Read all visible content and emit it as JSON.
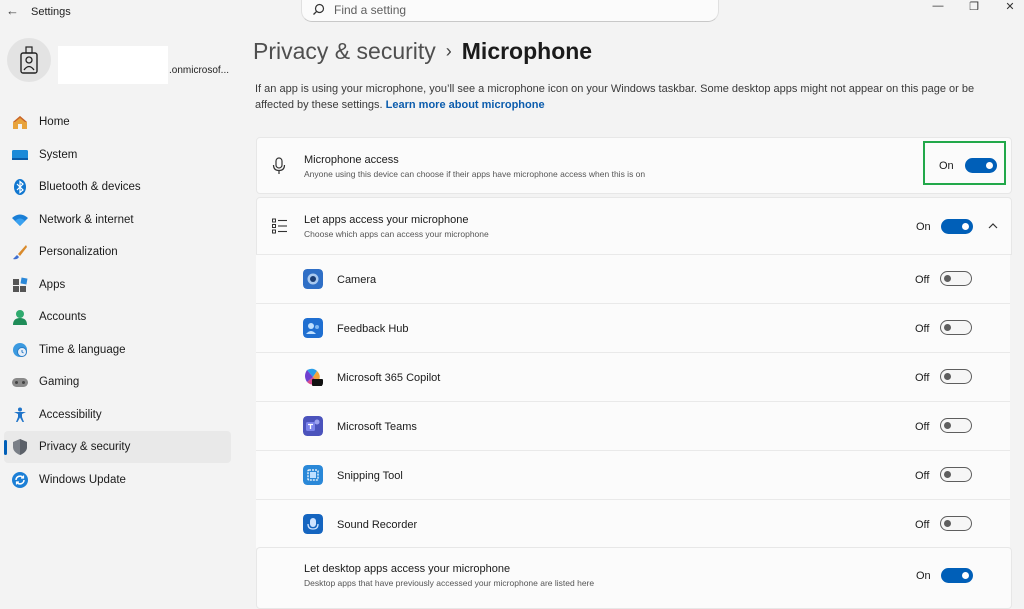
{
  "window": {
    "title": "Settings",
    "back_icon": "arrow-left-icon",
    "controls": [
      "minimize",
      "restore",
      "close"
    ]
  },
  "search": {
    "placeholder": "Find a setting"
  },
  "profile": {
    "account_suffix": ".onmicrosof..."
  },
  "sidebar": {
    "items": [
      {
        "label": "Home",
        "icon": "home-icon"
      },
      {
        "label": "System",
        "icon": "system-icon"
      },
      {
        "label": "Bluetooth & devices",
        "icon": "bluetooth-icon"
      },
      {
        "label": "Network & internet",
        "icon": "wifi-icon"
      },
      {
        "label": "Personalization",
        "icon": "brush-icon"
      },
      {
        "label": "Apps",
        "icon": "apps-icon"
      },
      {
        "label": "Accounts",
        "icon": "person-icon"
      },
      {
        "label": "Time & language",
        "icon": "clock-globe-icon"
      },
      {
        "label": "Gaming",
        "icon": "gamepad-icon"
      },
      {
        "label": "Accessibility",
        "icon": "accessibility-icon"
      },
      {
        "label": "Privacy & security",
        "icon": "shield-icon",
        "selected": true
      },
      {
        "label": "Windows Update",
        "icon": "update-icon"
      }
    ]
  },
  "breadcrumb": {
    "parent": "Privacy & security",
    "separator": "›",
    "current": "Microphone"
  },
  "description": {
    "text": "If an app is using your microphone, you’ll see a microphone icon on your Windows taskbar. Some desktop apps might not appear on this page or be affected by these settings.",
    "link": "Learn more about microphone"
  },
  "microphone_access": {
    "title": "Microphone access",
    "subtitle": "Anyone using this device can choose if their apps have microphone access when this is on",
    "state": "On"
  },
  "let_apps": {
    "title": "Let apps access your microphone",
    "subtitle": "Choose which apps can access your microphone",
    "state": "On",
    "apps": [
      {
        "name": "Camera",
        "state": "Off",
        "icon": "camera-app-icon",
        "color": "#3a7bd5"
      },
      {
        "name": "Feedback Hub",
        "state": "Off",
        "icon": "feedback-hub-icon",
        "color": "#1f6fd1"
      },
      {
        "name": "Microsoft 365 Copilot",
        "state": "Off",
        "icon": "m365-copilot-icon",
        "color": "#7b4dd8"
      },
      {
        "name": "Microsoft Teams",
        "state": "Off",
        "icon": "teams-icon",
        "color": "#4b53bc"
      },
      {
        "name": "Snipping Tool",
        "state": "Off",
        "icon": "snipping-tool-icon",
        "color": "#2a88d8"
      },
      {
        "name": "Sound Recorder",
        "state": "Off",
        "icon": "sound-recorder-icon",
        "color": "#1565c0"
      }
    ]
  },
  "desktop_apps": {
    "title": "Let desktop apps access your microphone",
    "subtitle": "Desktop apps that have previously accessed your microphone are listed here",
    "state": "On"
  },
  "colors": {
    "accent": "#005fb8",
    "highlight_border": "#22a84a"
  }
}
